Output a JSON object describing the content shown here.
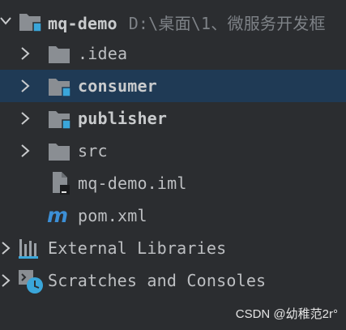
{
  "tree": {
    "root": {
      "name": "mq-demo",
      "path": "D:\\桌面\\1、微服务开发框"
    },
    "items": [
      {
        "label": ".idea"
      },
      {
        "label": "consumer"
      },
      {
        "label": "publisher"
      },
      {
        "label": "src"
      },
      {
        "label": "mq-demo.iml"
      },
      {
        "label": "pom.xml"
      },
      {
        "label": "External Libraries"
      },
      {
        "label": "Scratches and Consoles"
      }
    ]
  },
  "colors": {
    "background": "#2b2d30",
    "selection": "#1f3a55",
    "folder": "#8a8e93",
    "module_badge": "#3aa6da",
    "maven": "#3c8fd6"
  },
  "icons": {
    "arrow": "chevron-right-icon",
    "folder": "folder-icon",
    "module": "module-folder-icon",
    "iml": "iml-file-icon",
    "maven": "maven-icon",
    "libraries": "libraries-icon",
    "scratches": "scratches-icon"
  },
  "watermark": "CSDN @幼稚范2r°"
}
